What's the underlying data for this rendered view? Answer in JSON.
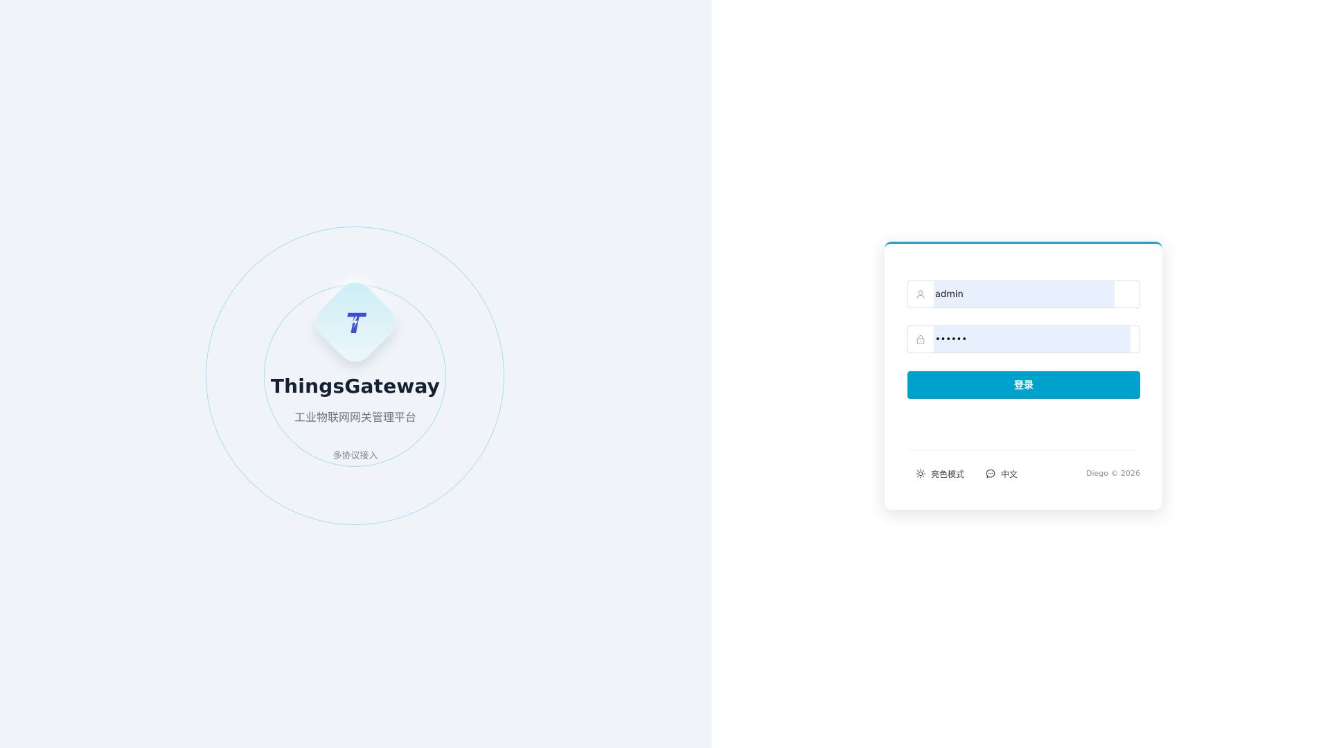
{
  "brand": {
    "title": "ThingsGateway",
    "subtitle": "工业物联网网关管理平台",
    "tagline": "多协议接入",
    "logo_letter": "T",
    "logo_icon": "lightning-t-logo-icon"
  },
  "login": {
    "username_value": "admin",
    "username_icon": "user-icon",
    "password_value": "••••••",
    "password_icon": "lock-icon",
    "submit_label": "登录"
  },
  "footer": {
    "theme_label": "亮色模式",
    "theme_icon": "sun-icon",
    "language_label": "中文",
    "language_icon": "chat-bubble-icon",
    "copyright": "Diego © 2026"
  },
  "colors": {
    "accent": "#00a2cc",
    "card_top_border": "#1fa0c9",
    "left_background": "#f0f4f9",
    "orbit_ring": "#a9dcea",
    "autofill_background": "#e8effd",
    "logo_glyph": "#3d4fd4"
  }
}
